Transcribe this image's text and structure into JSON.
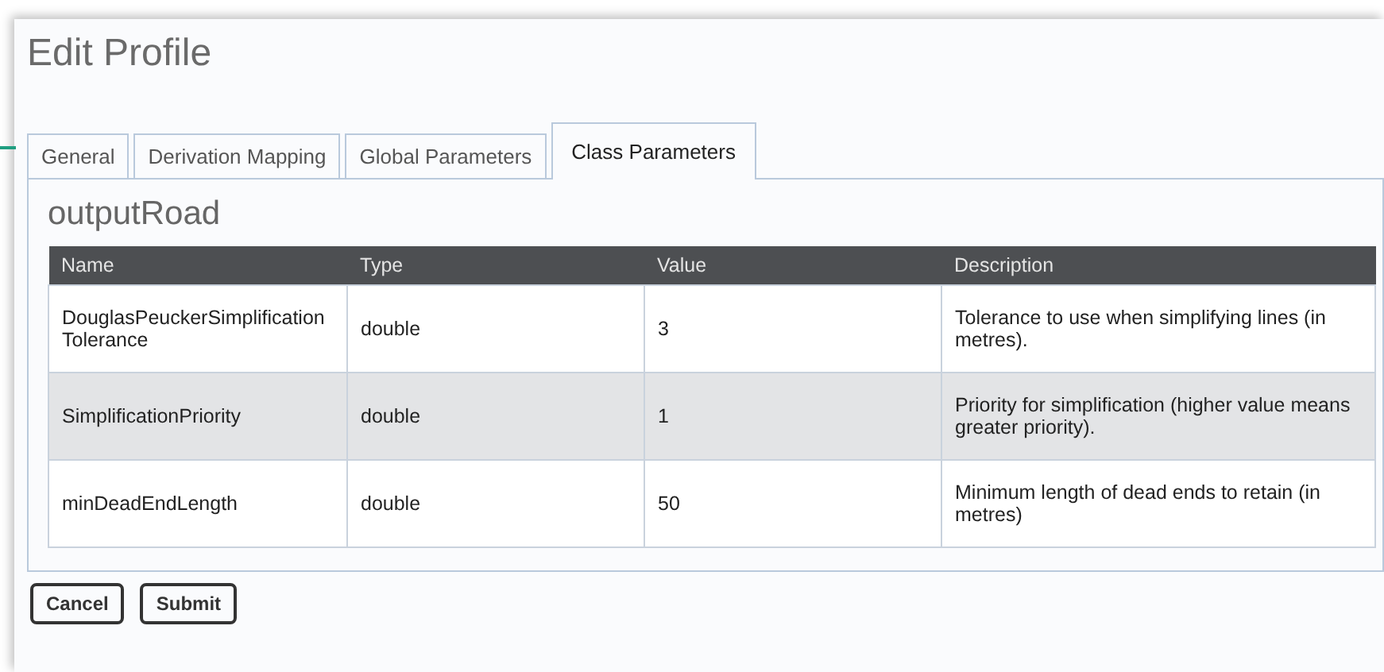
{
  "window": {
    "title": "Edit Profile"
  },
  "tabs": [
    {
      "label": "General",
      "selected": false
    },
    {
      "label": "Derivation Mapping",
      "selected": false
    },
    {
      "label": "Global Parameters",
      "selected": false
    },
    {
      "label": "Class Parameters",
      "selected": true
    }
  ],
  "section": {
    "heading": "outputRoad"
  },
  "table": {
    "columns": [
      "Name",
      "Type",
      "Value",
      "Description"
    ],
    "rows": [
      [
        "DouglasPeuckerSimplificationTolerance",
        "double",
        "3",
        "Tolerance to use when simplifying lines (in metres)."
      ],
      [
        "SimplificationPriority",
        "double",
        "1",
        "Priority for simplification (higher value means greater priority)."
      ],
      [
        "minDeadEndLength",
        "double",
        "50",
        "Minimum length of dead ends to retain (in metres)"
      ]
    ]
  },
  "buttons": [
    "Cancel",
    "Submit"
  ]
}
